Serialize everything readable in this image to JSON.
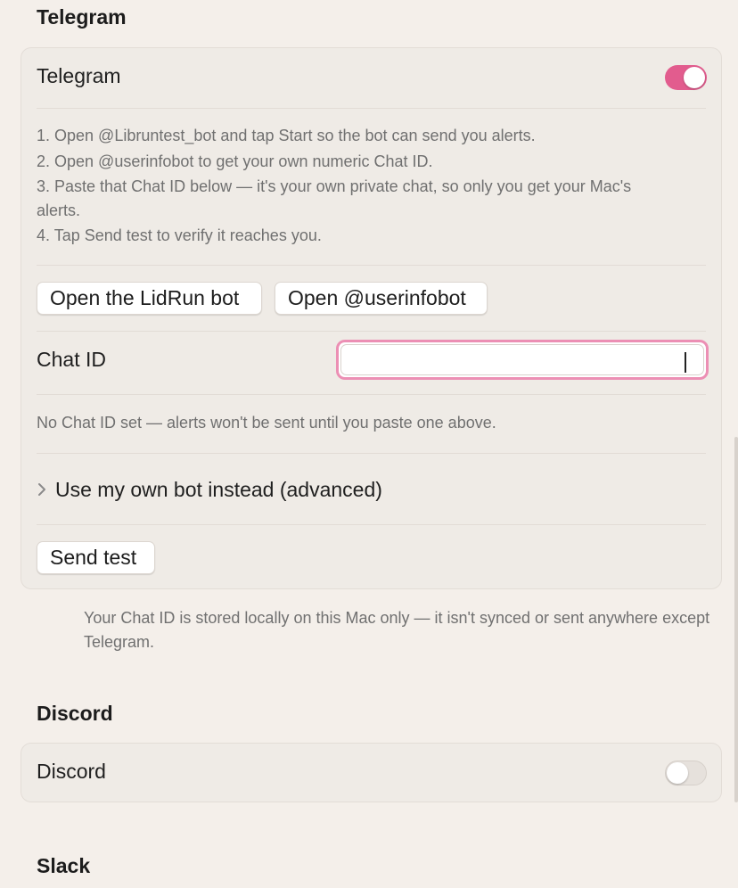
{
  "telegram": {
    "section_title": "Telegram",
    "toggle_label": "Telegram",
    "enabled": true,
    "instructions": [
      "1. Open @Libruntest_bot and tap Start so the bot can send you alerts.",
      "2. Open @userinfobot to get your own numeric Chat ID.",
      "3. Paste that Chat ID below — it's your own private chat, so only you get your Mac's alerts.",
      "4. Tap Send test to verify it reaches you."
    ],
    "open_bot_label": "Open the LidRun bot",
    "open_userinfobot_label": "Open @userinfobot",
    "chat_id_label": "Chat ID",
    "chat_id_value": "",
    "chat_id_hint": "No Chat ID set — alerts won't be sent until you paste one above.",
    "advanced_label": "Use my own bot instead (advanced)",
    "send_test_label": "Send test",
    "footnote": "Your Chat ID is stored locally on this Mac only — it isn't synced or sent anywhere except Telegram."
  },
  "discord": {
    "section_title": "Discord",
    "toggle_label": "Discord",
    "enabled": false
  },
  "slack": {
    "section_title": "Slack"
  },
  "colors": {
    "accent": "#e25c8e",
    "focus_ring": "#ec8fb4",
    "background": "#f4efea",
    "card": "#efebe6"
  },
  "icons": {
    "disclosure": "chevron-right-icon"
  }
}
